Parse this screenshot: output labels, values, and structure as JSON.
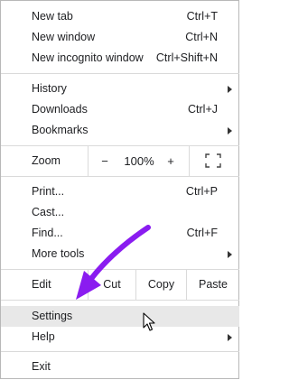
{
  "menu": {
    "group1": [
      {
        "label": "New tab",
        "shortcut": "Ctrl+T"
      },
      {
        "label": "New window",
        "shortcut": "Ctrl+N"
      },
      {
        "label": "New incognito window",
        "shortcut": "Ctrl+Shift+N"
      }
    ],
    "group2": [
      {
        "label": "History",
        "has_submenu": true
      },
      {
        "label": "Downloads",
        "shortcut": "Ctrl+J"
      },
      {
        "label": "Bookmarks",
        "has_submenu": true
      }
    ],
    "zoom": {
      "label": "Zoom",
      "minus": "−",
      "level": "100%",
      "plus": "+",
      "fullscreen_icon": "fullscreen-icon"
    },
    "group3": [
      {
        "label": "Print...",
        "shortcut": "Ctrl+P"
      },
      {
        "label": "Cast..."
      },
      {
        "label": "Find...",
        "shortcut": "Ctrl+F"
      },
      {
        "label": "More tools",
        "has_submenu": true
      }
    ],
    "edit": {
      "label": "Edit",
      "cut": "Cut",
      "copy": "Copy",
      "paste": "Paste"
    },
    "group4": [
      {
        "label": "Settings",
        "highlighted": true
      },
      {
        "label": "Help",
        "has_submenu": true
      }
    ],
    "exit": {
      "label": "Exit"
    }
  },
  "colors": {
    "annotation_arrow": "#8a1cf0",
    "highlight": "#e8e8e8"
  }
}
